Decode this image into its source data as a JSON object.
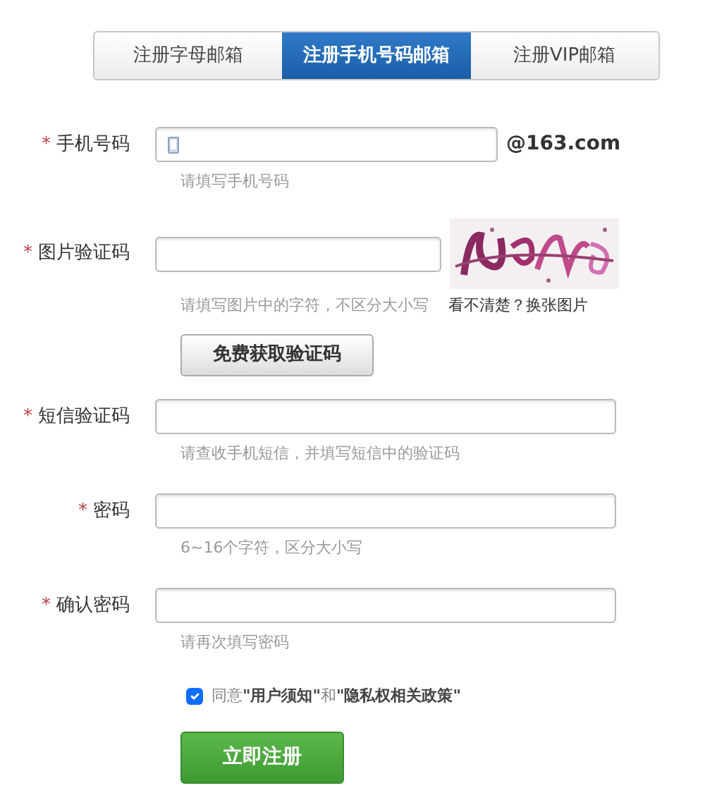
{
  "tabs": [
    {
      "label": "注册字母邮箱",
      "selected": false
    },
    {
      "label": "注册手机号码邮箱",
      "selected": true
    },
    {
      "label": "注册VIP邮箱",
      "selected": false
    }
  ],
  "fields": [
    {
      "label": "手机号码",
      "required_mark": "*",
      "kind": "phone",
      "suffix": "@163.com",
      "hint": "请填写手机号码"
    },
    {
      "label": "图片验证码",
      "required_mark": "*",
      "kind": "captcha",
      "hint": "请填写图片中的字符，不区分大小写",
      "refresh_link": "看不清楚？换张图片",
      "action_button": "免费获取验证码"
    },
    {
      "label": "短信验证码",
      "required_mark": "*",
      "kind": "text",
      "hint": "请查收手机短信，并填写短信中的验证码"
    },
    {
      "label": "密码",
      "required_mark": "*",
      "kind": "password",
      "hint": "6~16个字符，区分大小写"
    },
    {
      "label": "确认密码",
      "required_mark": "*",
      "kind": "password",
      "hint": "请再次填写密码"
    }
  ],
  "agreement": {
    "text": "同意**\"用户须知\"**和**\"隐私权相关政策\"**",
    "checked": true
  },
  "submit_button": "立即注册"
}
